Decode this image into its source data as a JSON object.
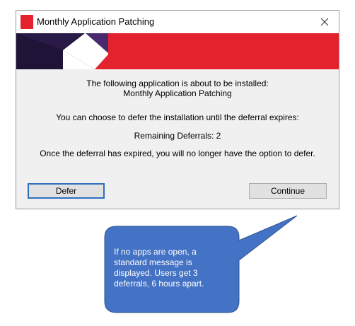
{
  "window": {
    "title": "Monthly Application Patching",
    "close_glyph": "✕"
  },
  "message": {
    "line1": "The following application is about to be installed:",
    "line2": "Monthly Application Patching",
    "line3": "You can choose to defer the installation until the deferral expires:",
    "line4": "Remaining Deferrals: 2",
    "line5": "Once the deferral has expired, you will no longer have the option to defer."
  },
  "buttons": {
    "defer_label": "Defer",
    "continue_label": "Continue"
  },
  "callout": {
    "text": "If no apps are open, a standard message is displayed. Users get 3 deferrals, 6 hours apart."
  },
  "colors": {
    "brand_red": "#e3222d",
    "banner_dark": "#1f1437",
    "banner_purple": "#4a2a6e",
    "callout_fill": "#4472c4",
    "callout_border": "#2f528f",
    "focus_border": "#2f6fc0"
  },
  "icons": {
    "app": "app-icon-red-square",
    "close": "close-icon"
  }
}
